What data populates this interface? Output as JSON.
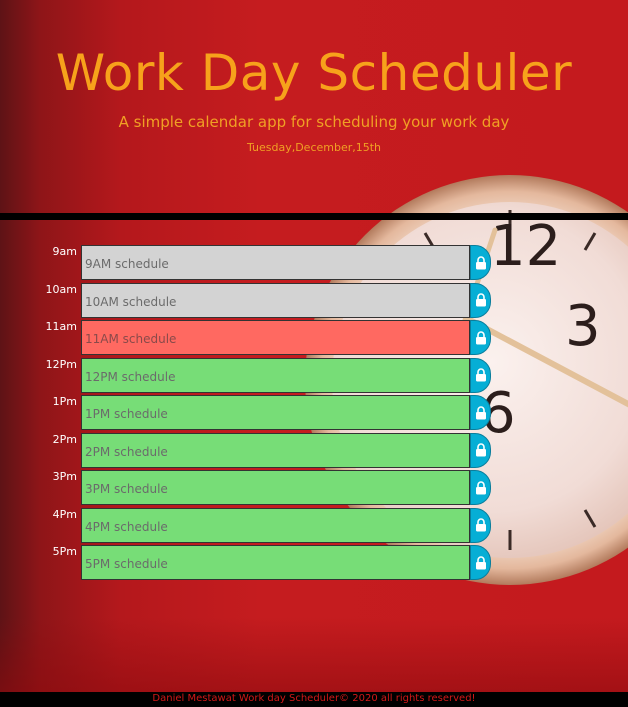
{
  "header": {
    "title": "Work Day Scheduler",
    "subtitle": "A simple calendar app for scheduling your work day",
    "date": "Tuesday,December,15th"
  },
  "colors": {
    "title": "#f7a21b",
    "past": "#d3d3d3",
    "present": "#ff6961",
    "future": "#77dd77",
    "save": "#06aed5"
  },
  "schedule": [
    {
      "hour": "9am",
      "text": "9AM schedule",
      "state": "past"
    },
    {
      "hour": "10am",
      "text": "10AM schedule",
      "state": "past"
    },
    {
      "hour": "11am",
      "text": "11AM schedule",
      "state": "present"
    },
    {
      "hour": "12Pm",
      "text": "12PM schedule",
      "state": "future"
    },
    {
      "hour": "1Pm",
      "text": "1PM schedule",
      "state": "future"
    },
    {
      "hour": "2Pm",
      "text": "2PM schedule",
      "state": "future"
    },
    {
      "hour": "3Pm",
      "text": "3PM schedule",
      "state": "future"
    },
    {
      "hour": "4Pm",
      "text": "4PM schedule",
      "state": "future"
    },
    {
      "hour": "5Pm",
      "text": "5PM schedule",
      "state": "future"
    }
  ],
  "save_icon": "lock-icon",
  "footer": {
    "text": "Daniel Mestawat Work day Scheduler© 2020 all rights reserved!"
  }
}
